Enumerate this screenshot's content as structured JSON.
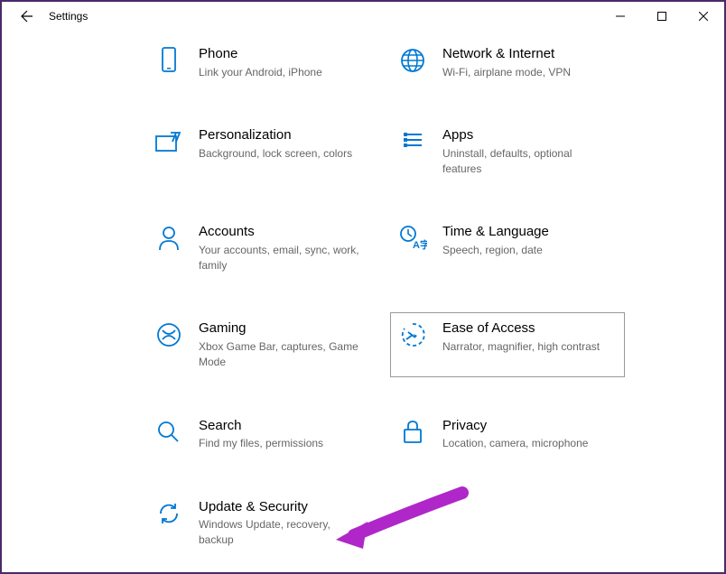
{
  "window": {
    "title": "Settings"
  },
  "categories": [
    {
      "id": "phone",
      "title": "Phone",
      "desc": "Link your Android, iPhone"
    },
    {
      "id": "network",
      "title": "Network & Internet",
      "desc": "Wi-Fi, airplane mode, VPN"
    },
    {
      "id": "personalization",
      "title": "Personalization",
      "desc": "Background, lock screen, colors"
    },
    {
      "id": "apps",
      "title": "Apps",
      "desc": "Uninstall, defaults, optional features"
    },
    {
      "id": "accounts",
      "title": "Accounts",
      "desc": "Your accounts, email, sync, work, family"
    },
    {
      "id": "time",
      "title": "Time & Language",
      "desc": "Speech, region, date"
    },
    {
      "id": "gaming",
      "title": "Gaming",
      "desc": "Xbox Game Bar, captures, Game Mode"
    },
    {
      "id": "ease",
      "title": "Ease of Access",
      "desc": "Narrator, magnifier, high contrast",
      "hover": true
    },
    {
      "id": "search",
      "title": "Search",
      "desc": "Find my files, permissions"
    },
    {
      "id": "privacy",
      "title": "Privacy",
      "desc": "Location, camera, microphone"
    },
    {
      "id": "update",
      "title": "Update & Security",
      "desc": "Windows Update, recovery, backup"
    }
  ],
  "colors": {
    "accent": "#0078d4",
    "annotation": "#b027c9"
  }
}
